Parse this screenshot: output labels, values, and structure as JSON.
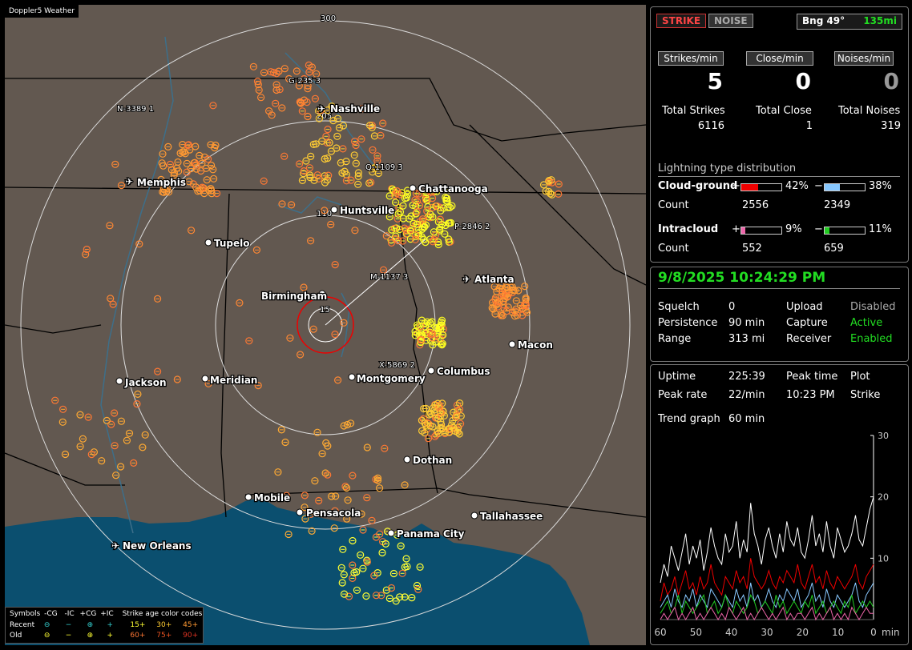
{
  "app": {
    "title": "Doppler5 Weather"
  },
  "map": {
    "bearing_degrees": 300,
    "ring_labels": [
      "300",
      "205",
      "110",
      "15"
    ],
    "cities": [
      {
        "name": "Nashville",
        "icon": "airport-icon"
      },
      {
        "name": "Memphis",
        "icon": "airport-icon"
      },
      {
        "name": "Chattanooga",
        "icon": "city-dot-icon"
      },
      {
        "name": "Huntsville",
        "icon": "city-dot-icon"
      },
      {
        "name": "Tupelo",
        "icon": "city-dot-icon"
      },
      {
        "name": "Atlanta",
        "icon": "airport-icon"
      },
      {
        "name": "Birmingham",
        "icon": "city-dot-icon"
      },
      {
        "name": "Macon",
        "icon": "city-dot-icon"
      },
      {
        "name": "Jackson",
        "icon": "city-dot-icon"
      },
      {
        "name": "Meridian",
        "icon": "city-dot-icon"
      },
      {
        "name": "Montgomery",
        "icon": "city-dot-icon"
      },
      {
        "name": "Columbus",
        "icon": "city-dot-icon"
      },
      {
        "name": "Dothan",
        "icon": "city-dot-icon"
      },
      {
        "name": "Mobile",
        "icon": "city-dot-icon"
      },
      {
        "name": "Pensacola",
        "icon": "city-dot-icon"
      },
      {
        "name": "Tallahassee",
        "icon": "city-dot-icon"
      },
      {
        "name": "Panama City",
        "icon": "city-dot-icon"
      },
      {
        "name": "New Orleans",
        "icon": "airport-icon"
      }
    ],
    "cell_labels": [
      "G-235 3",
      "N-3389 1",
      "Q-1109 3",
      "P-2846 2",
      "M-1137 3",
      "X-5869 2"
    ]
  },
  "legend": {
    "header": [
      "Symbols",
      "-CG",
      "-IC",
      "+CG",
      "+IC",
      "Strike age color codes"
    ],
    "recent_label": "Recent",
    "old_label": "Old",
    "recent_ages": [
      "15+",
      "30+",
      "45+"
    ],
    "old_ages": [
      "60+",
      "75+",
      "90+"
    ],
    "symbols": [
      "⊖",
      "−",
      "⊕",
      "+"
    ]
  },
  "status": {
    "strike_button": "STRIKE",
    "noise_button": "NOISE",
    "bearing": "Bng 49°",
    "distance": "135mi"
  },
  "rates": {
    "headers": [
      "Strikes/min",
      "Close/min",
      "Noises/min"
    ],
    "values": [
      "5",
      "0",
      "0"
    ],
    "total_labels": [
      "Total Strikes",
      "Total Close",
      "Total Noises"
    ],
    "totals": [
      "6116",
      "1",
      "319"
    ]
  },
  "distribution": {
    "title": "Lightning type distribution",
    "cg_label": "Cloud-ground",
    "ic_label": "Intracloud",
    "count_label": "Count",
    "plus": "+",
    "minus": "−",
    "cg_pos_pct": "42%",
    "cg_neg_pct": "38%",
    "ic_pos_pct": "9%",
    "ic_neg_pct": "11%",
    "cg_pos_frac": 0.42,
    "cg_neg_frac": 0.38,
    "ic_pos_frac": 0.09,
    "ic_neg_frac": 0.11,
    "cg_pos_count": "2556",
    "cg_neg_count": "2349",
    "ic_pos_count": "552",
    "ic_neg_count": "659",
    "colors": {
      "cg_pos": "#ee0000",
      "cg_neg": "#88c8ff",
      "ic_pos": "#ee66aa",
      "ic_neg": "#22cc22"
    }
  },
  "settings": {
    "datetime": "9/8/2025 10:24:29 PM",
    "rows": [
      {
        "k1": "Squelch",
        "v1": "0",
        "k2": "Upload",
        "v2": "Disabled"
      },
      {
        "k1": "Persistence",
        "v1": "90 min",
        "k2": "Capture",
        "v2": "Active"
      },
      {
        "k1": "Range",
        "v1": "313 mi",
        "k2": "Receiver",
        "v2": "Enabled"
      }
    ]
  },
  "stats": {
    "uptime_label": "Uptime",
    "uptime": "225:39",
    "peak_time_label": "Peak time",
    "peak_time": "10:23 PM",
    "plot_label": "Plot",
    "plot": "Strike",
    "peak_rate_label": "Peak rate",
    "peak_rate": "22/min",
    "trend_label": "Trend graph",
    "trend": "60 min"
  },
  "chart_data": {
    "type": "line",
    "x_ticks": [
      "60",
      "50",
      "40",
      "30",
      "20",
      "10",
      "0"
    ],
    "x_unit": "min",
    "y_ticks": [
      "30",
      "20",
      "10"
    ],
    "ylim": [
      0,
      30
    ],
    "series": [
      {
        "color": "#ffffff",
        "values": [
          6,
          9,
          7,
          12,
          10,
          8,
          11,
          14,
          9,
          12,
          10,
          13,
          8,
          11,
          15,
          12,
          10,
          9,
          14,
          11,
          12,
          16,
          10,
          13,
          11,
          19,
          14,
          12,
          9,
          13,
          15,
          12,
          10,
          14,
          11,
          16,
          13,
          12,
          15,
          11,
          10,
          13,
          17,
          12,
          14,
          11,
          16,
          12,
          10,
          15,
          13,
          11,
          12,
          14,
          17,
          13,
          12,
          15,
          18,
          20
        ]
      },
      {
        "color": "#ee0000",
        "values": [
          3,
          6,
          4,
          5,
          7,
          4,
          6,
          8,
          5,
          6,
          4,
          7,
          5,
          6,
          9,
          6,
          5,
          4,
          7,
          6,
          5,
          8,
          6,
          7,
          5,
          10,
          7,
          6,
          5,
          6,
          8,
          6,
          5,
          7,
          6,
          8,
          7,
          6,
          9,
          6,
          5,
          7,
          9,
          6,
          7,
          5,
          8,
          6,
          5,
          7,
          6,
          5,
          6,
          7,
          9,
          6,
          5,
          7,
          8,
          9
        ]
      },
      {
        "color": "#88c8ff",
        "values": [
          2,
          3,
          4,
          2,
          5,
          3,
          2,
          4,
          3,
          5,
          2,
          4,
          3,
          2,
          5,
          4,
          3,
          2,
          4,
          3,
          2,
          5,
          3,
          4,
          2,
          6,
          3,
          4,
          2,
          3,
          5,
          3,
          2,
          4,
          3,
          5,
          4,
          3,
          5,
          2,
          3,
          4,
          6,
          3,
          4,
          2,
          5,
          3,
          2,
          4,
          3,
          2,
          3,
          4,
          6,
          3,
          2,
          4,
          5,
          6
        ]
      },
      {
        "color": "#22cc22",
        "values": [
          1,
          2,
          3,
          1,
          2,
          4,
          1,
          3,
          2,
          1,
          2,
          3,
          4,
          1,
          2,
          3,
          1,
          2,
          4,
          2,
          1,
          3,
          2,
          1,
          2,
          4,
          3,
          1,
          2,
          3,
          2,
          1,
          4,
          2,
          3,
          1,
          2,
          3,
          2,
          1,
          3,
          2,
          4,
          1,
          2,
          3,
          1,
          2,
          3,
          2,
          1,
          3,
          2,
          4,
          1,
          2,
          3,
          2,
          3,
          2
        ]
      },
      {
        "color": "#ee66aa",
        "values": [
          0,
          1,
          0,
          1,
          2,
          0,
          1,
          0,
          1,
          2,
          0,
          1,
          0,
          1,
          2,
          1,
          0,
          1,
          0,
          2,
          1,
          0,
          1,
          2,
          0,
          1,
          0,
          1,
          2,
          1,
          0,
          1,
          0,
          1,
          2,
          0,
          1,
          0,
          1,
          1,
          0,
          1,
          2,
          0,
          1,
          0,
          1,
          2,
          0,
          1,
          0,
          1,
          0,
          2,
          1,
          0,
          1,
          2,
          1,
          1
        ]
      }
    ]
  }
}
